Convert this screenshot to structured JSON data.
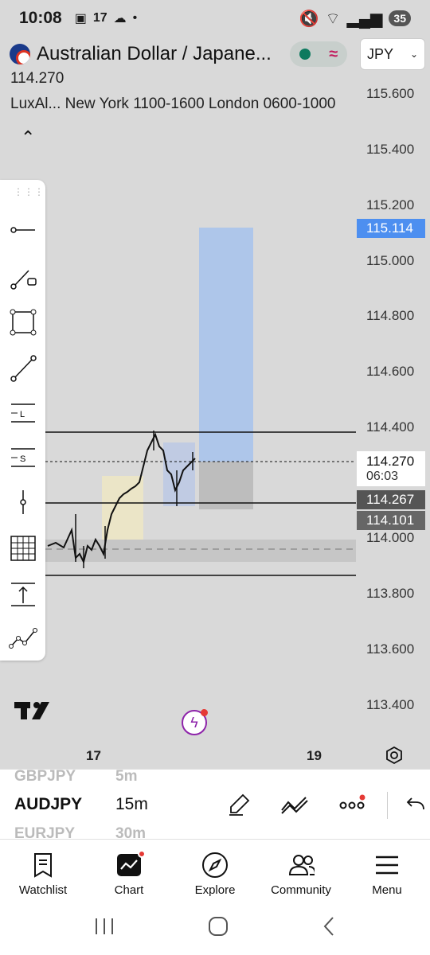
{
  "status": {
    "time": "10:08",
    "battery": "35"
  },
  "header": {
    "symbol_title": "Australian Dollar / Japane...",
    "price": "114.270",
    "indicator": "LuxAl...  New York 1100-1600 London 0600-1000",
    "currency": "JPY"
  },
  "axis": {
    "ticks": [
      "115.600",
      "115.400",
      "115.200",
      "115.000",
      "114.800",
      "114.600",
      "114.400",
      "114.000",
      "113.800",
      "113.600",
      "113.400"
    ],
    "tag_target": "115.114",
    "tag_current": "114.270",
    "tag_countdown": "06:03",
    "tag_line1": "114.267",
    "tag_line2": "114.101"
  },
  "time_axis": {
    "left": "17",
    "right": "19"
  },
  "interval_bar": {
    "prev_symbol": "GBPJPY",
    "prev_interval": "5m",
    "symbol": "AUDJPY",
    "interval": "15m",
    "next_symbol": "EURJPY",
    "next_interval": "30m"
  },
  "tabs": [
    {
      "label": "Watchlist",
      "icon": "watchlist-icon"
    },
    {
      "label": "Chart",
      "icon": "chart-icon"
    },
    {
      "label": "Explore",
      "icon": "compass-icon"
    },
    {
      "label": "Community",
      "icon": "community-icon"
    },
    {
      "label": "Menu",
      "icon": "menu-icon"
    }
  ],
  "colors": {
    "accent_blue": "#4d8ff0",
    "target_box": "#aec6ea",
    "stop_box": "#bdbdbd",
    "brand": "#111111"
  }
}
